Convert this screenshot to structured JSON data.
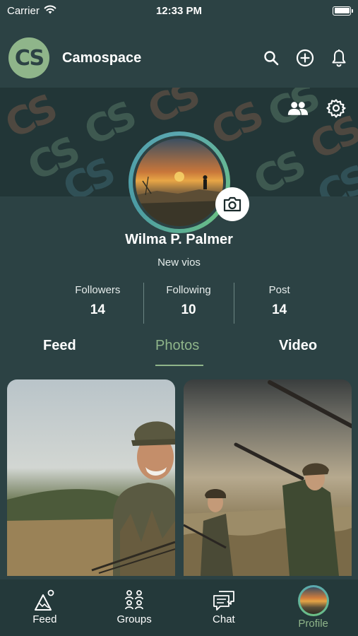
{
  "status_bar": {
    "carrier": "Carrier",
    "time": "12:33 PM"
  },
  "header": {
    "logo_text": "CS",
    "title": "Camospace",
    "actions": [
      "search-icon",
      "add-icon",
      "bell-icon"
    ]
  },
  "cover": {
    "pattern_text": "CS",
    "actions": [
      "friends-icon",
      "settings-icon"
    ]
  },
  "profile": {
    "name": "Wilma P. Palmer",
    "bio": "New vios",
    "stats": [
      {
        "label": "Followers",
        "value": "14"
      },
      {
        "label": "Following",
        "value": "10"
      },
      {
        "label": "Post",
        "value": "14"
      }
    ]
  },
  "tabs": [
    {
      "label": "Feed",
      "active": false
    },
    {
      "label": "Photos",
      "active": true
    },
    {
      "label": "Video",
      "active": false
    }
  ],
  "photos": [
    {
      "subject": "hunter-portrait"
    },
    {
      "subject": "hunters-with-shotguns"
    }
  ],
  "bottom_nav": [
    {
      "label": "Feed",
      "icon": "feed-icon",
      "active": false
    },
    {
      "label": "Groups",
      "icon": "groups-icon",
      "active": false
    },
    {
      "label": "Chat",
      "icon": "chat-icon",
      "active": false
    },
    {
      "label": "Profile",
      "icon": "profile-avatar",
      "active": true
    }
  ],
  "colors": {
    "background": "#2c4244",
    "cover": "#223637",
    "accent": "#8fb58a",
    "ring_teal": "#5aa7b0",
    "ring_green": "#6cc184",
    "nav": "#24393a"
  }
}
